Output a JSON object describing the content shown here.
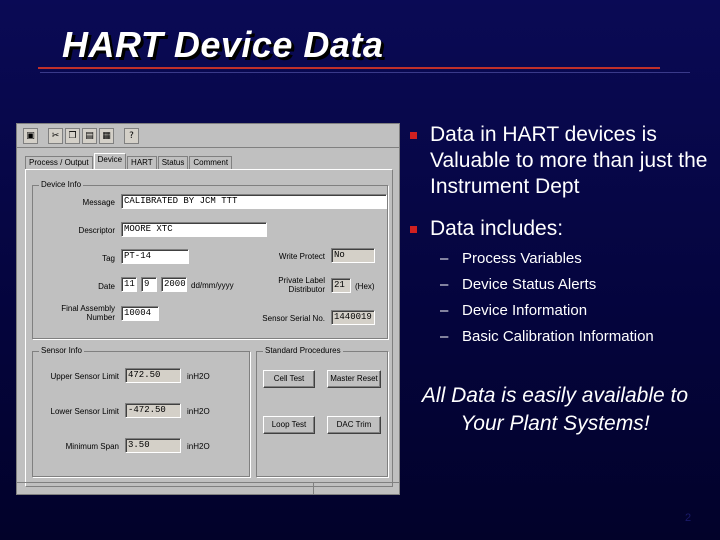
{
  "slide": {
    "title": "HART Device Data",
    "page_number": "2",
    "accent_color": "#c0302a",
    "bullet_color": "#d02020"
  },
  "bullets": [
    {
      "text": "Data in HART devices is Valuable to more than just the Instrument Dept"
    },
    {
      "text": "Data includes:"
    }
  ],
  "sub_bullets": [
    "Process Variables",
    "Device Status Alerts",
    "Device Information",
    "Basic Calibration Information"
  ],
  "callout": "All Data is easily available to Your Plant Systems!",
  "window": {
    "toolbar_icons": [
      "save-icon",
      "cut-icon",
      "copy-icon",
      "paste-icon",
      "print-icon",
      "help-icon"
    ],
    "tabs": [
      "Process / Output",
      "Device",
      "HART",
      "Status",
      "Comment"
    ],
    "active_tab": "Device",
    "device_info": {
      "group_title": "Device Info",
      "message_label": "Message",
      "message_value": "CALIBRATED BY JCM TTT",
      "descriptor_label": "Descriptor",
      "descriptor_value": "MOORE XTC",
      "tag_label": "Tag",
      "tag_value": "PT-14",
      "date_label": "Date",
      "date_month": "11",
      "date_day": "9",
      "date_year": "2000",
      "date_format": "dd/mm/yyyy",
      "final_assembly_label": "Final Assembly Number",
      "final_assembly_value": "10004",
      "write_protect_label": "Write Protect",
      "write_protect_value": "No",
      "private_label_label": "Private Label Distributor",
      "private_label_value": "21",
      "private_label_unit": "(Hex)",
      "sensor_serial_label": "Sensor Serial No.",
      "sensor_serial_value": "1440019"
    },
    "sensor_info": {
      "group_title": "Sensor Info",
      "upper_label": "Upper Sensor Limit",
      "upper_value": "472.50",
      "upper_unit": "inH2O",
      "lower_label": "Lower Sensor Limit",
      "lower_value": "-472.50",
      "lower_unit": "inH2O",
      "span_label": "Minimum Span",
      "span_value": "3.50",
      "span_unit": "inH2O"
    },
    "standard_procedures": {
      "group_title": "Standard Procedures",
      "cell_test": "Cell Test",
      "master_reset": "Master Reset",
      "loop_test": "Loop Test",
      "dac_trim": "DAC Trim"
    }
  }
}
